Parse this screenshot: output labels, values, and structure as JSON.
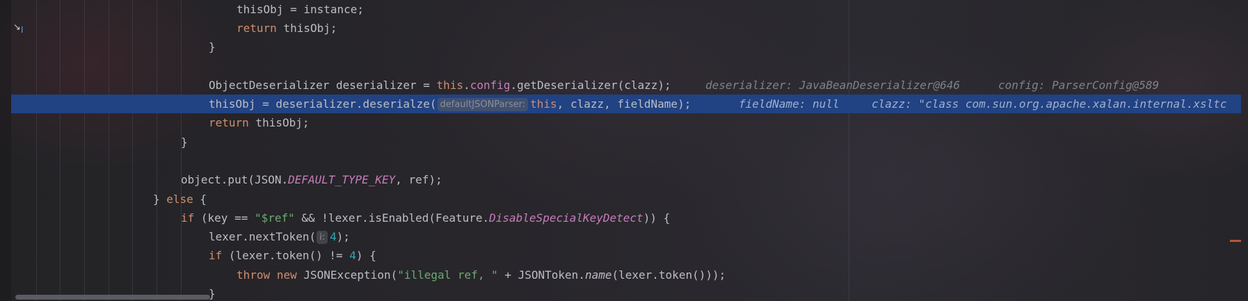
{
  "lines": [
    {
      "id": 1,
      "segments": [
        [
          "",
          "thisObj = instance;"
        ]
      ]
    },
    {
      "id": 2,
      "segments": [
        [
          "kw",
          "return"
        ],
        [
          "",
          " thisObj;"
        ]
      ]
    },
    {
      "id": 3,
      "segments": [
        [
          "",
          "}"
        ]
      ]
    },
    {
      "id": 4,
      "segments": []
    },
    {
      "id": 5,
      "segments": [
        [
          "",
          "ObjectDeserializer deserializer = "
        ],
        [
          "kw",
          "this"
        ],
        [
          "",
          "."
        ],
        [
          "fld",
          "config"
        ],
        [
          "",
          ".getDeserializer(clazz);"
        ]
      ]
    },
    {
      "id": 6,
      "segments": [
        [
          "",
          "thisObj = deserializer.deserialze("
        ],
        [
          "hint",
          "defaultJSONParser:"
        ],
        [
          "kw",
          "this"
        ],
        [
          "",
          ", clazz, fieldName);"
        ]
      ]
    },
    {
      "id": 7,
      "segments": [
        [
          "kw",
          "return"
        ],
        [
          "",
          " thisObj;"
        ]
      ]
    },
    {
      "id": 8,
      "segments": [
        [
          "",
          "}"
        ]
      ]
    },
    {
      "id": 9,
      "segments": []
    },
    {
      "id": 10,
      "segments": [
        [
          "",
          "object.put(JSON."
        ],
        [
          "const",
          "DEFAULT_TYPE_KEY"
        ],
        [
          "",
          ", ref);"
        ]
      ]
    },
    {
      "id": 11,
      "segments": [
        [
          "",
          "} "
        ],
        [
          "kw",
          "else"
        ],
        [
          "",
          " {"
        ]
      ]
    },
    {
      "id": 12,
      "segments": [
        [
          "kw",
          "if"
        ],
        [
          "",
          " (key == "
        ],
        [
          "str",
          "\"$ref\""
        ],
        [
          "",
          " && !lexer.isEnabled(Feature."
        ],
        [
          "const",
          "DisableSpecialKeyDetect"
        ],
        [
          "",
          ")) {"
        ]
      ]
    },
    {
      "id": 13,
      "segments": [
        [
          "",
          "lexer.nextToken("
        ],
        [
          "hint",
          "i:"
        ],
        [
          "num",
          "4"
        ],
        [
          "",
          ");"
        ]
      ]
    },
    {
      "id": 14,
      "segments": [
        [
          "kw",
          "if"
        ],
        [
          "",
          " (lexer.token() != "
        ],
        [
          "num",
          "4"
        ],
        [
          "",
          ") {"
        ]
      ]
    },
    {
      "id": 15,
      "segments": [
        [
          "kw",
          "throw"
        ],
        [
          "",
          " "
        ],
        [
          "kw",
          "new"
        ],
        [
          "",
          " JSONException("
        ],
        [
          "str",
          "\"illegal ref, \""
        ],
        [
          "",
          " + JSONToken."
        ],
        [
          "ital",
          "name"
        ],
        [
          "",
          "(lexer.token()));"
        ]
      ]
    },
    {
      "id": 16,
      "segments": [
        [
          "",
          "}"
        ]
      ]
    }
  ],
  "inline_values": {
    "line5": [
      "deserializer: JavaBeanDeserializer@646",
      "config: ParserConfig@589"
    ],
    "line6": [
      "fieldName: null",
      "clazz: \"class com.sun.org.apache.xalan.internal.xsltc"
    ]
  },
  "colors": {
    "keyword": "#cf8e6d",
    "string": "#6aab73",
    "number": "#2aacb8",
    "field": "#c77dbb",
    "execution_line": "#214283",
    "text": "#bcbec4"
  },
  "icons": {
    "gutter": "step-into-cursor-icon"
  }
}
